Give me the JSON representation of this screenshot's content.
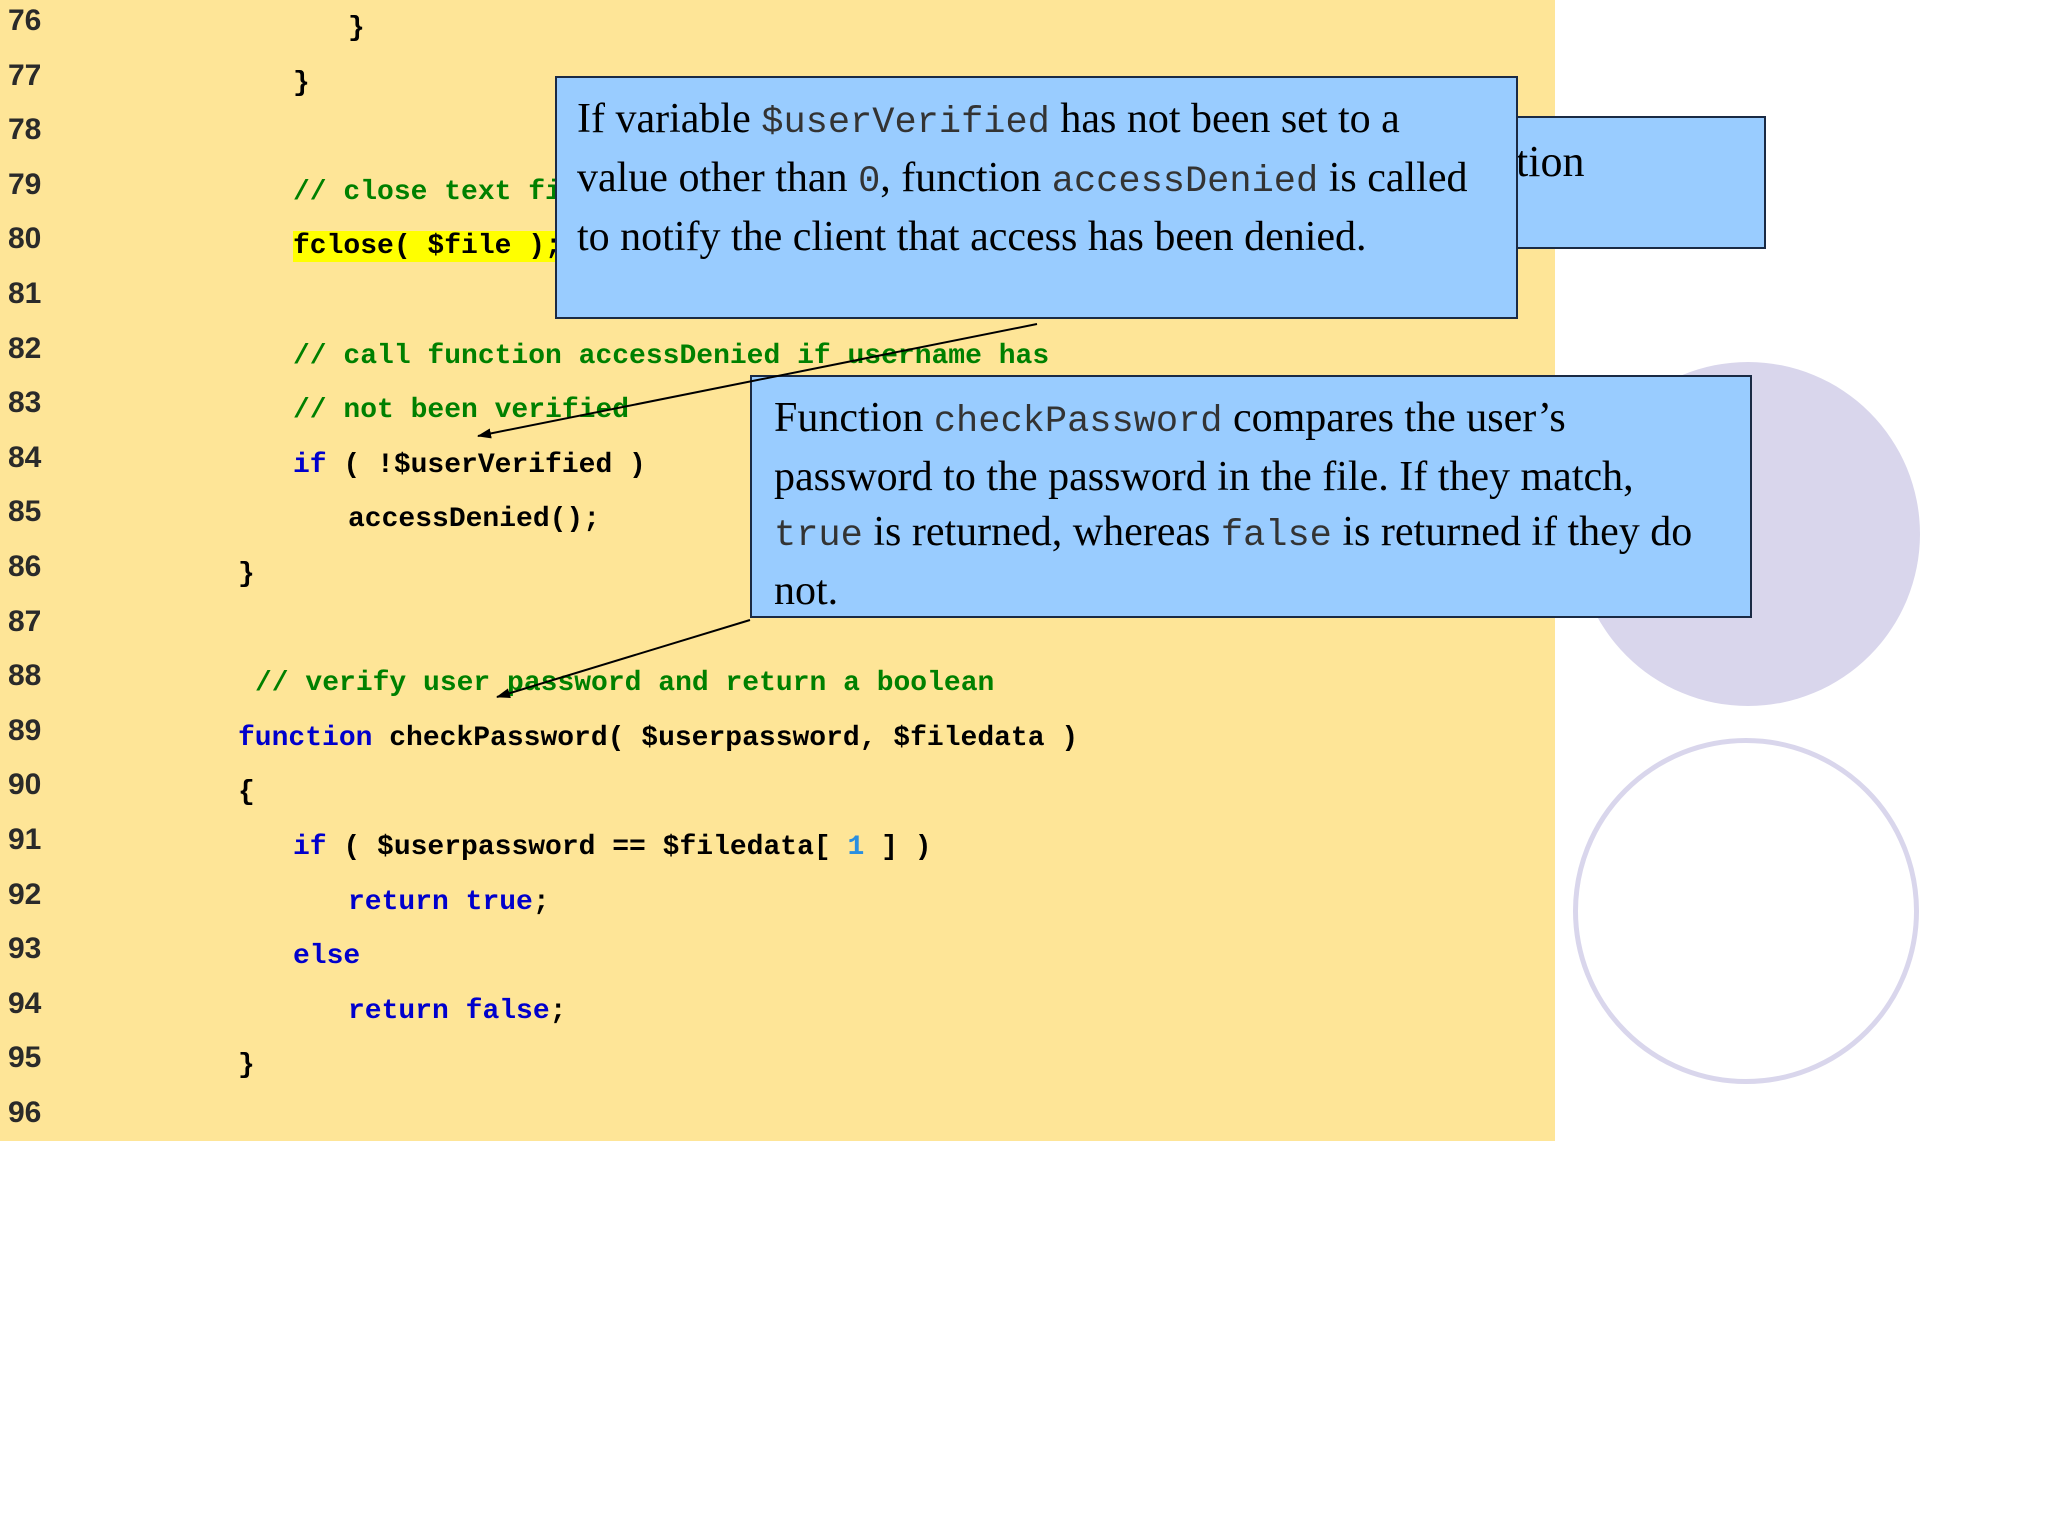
{
  "code_lines": [
    {
      "num": "76",
      "indent": 348,
      "parts": [
        {
          "t": "}",
          "c": ""
        }
      ]
    },
    {
      "num": "77",
      "indent": 293,
      "parts": [
        {
          "t": "}",
          "c": ""
        }
      ]
    },
    {
      "num": "78",
      "indent": 293,
      "parts": []
    },
    {
      "num": "79",
      "indent": 293,
      "parts": [
        {
          "t": "// close text file",
          "c": "cm"
        }
      ]
    },
    {
      "num": "80",
      "indent": 293,
      "parts": [
        {
          "t": "fclose( $file );",
          "c": "hl"
        }
      ]
    },
    {
      "num": "81",
      "indent": 293,
      "parts": []
    },
    {
      "num": "82",
      "indent": 293,
      "parts": [
        {
          "t": "// call function accessDenied if username has",
          "c": "cm"
        }
      ]
    },
    {
      "num": "83",
      "indent": 293,
      "parts": [
        {
          "t": "// not been verified",
          "c": "cm"
        }
      ]
    },
    {
      "num": "84",
      "indent": 293,
      "parts": [
        {
          "t": "if",
          "c": "kw"
        },
        {
          "t": " ( !$userVerified )",
          "c": ""
        }
      ]
    },
    {
      "num": "85",
      "indent": 348,
      "parts": [
        {
          "t": "accessDenied();",
          "c": ""
        }
      ]
    },
    {
      "num": "86",
      "indent": 238,
      "parts": [
        {
          "t": "}",
          "c": ""
        }
      ]
    },
    {
      "num": "87",
      "indent": 238,
      "parts": []
    },
    {
      "num": "88",
      "indent": 255,
      "parts": [
        {
          "t": "// verify user password and return a boolean",
          "c": "cm"
        }
      ]
    },
    {
      "num": "89",
      "indent": 238,
      "parts": [
        {
          "t": "function",
          "c": "kw"
        },
        {
          "t": " checkPassword( $userpassword, $filedata )",
          "c": ""
        }
      ]
    },
    {
      "num": "90",
      "indent": 238,
      "parts": [
        {
          "t": "{",
          "c": ""
        }
      ]
    },
    {
      "num": "91",
      "indent": 293,
      "parts": [
        {
          "t": "if",
          "c": "kw"
        },
        {
          "t": " ( $userpassword == $filedata[ ",
          "c": ""
        },
        {
          "t": "1",
          "c": "num"
        },
        {
          "t": " ] )",
          "c": ""
        }
      ]
    },
    {
      "num": "92",
      "indent": 348,
      "parts": [
        {
          "t": "return",
          "c": "kw"
        },
        {
          "t": " ",
          "c": ""
        },
        {
          "t": "true",
          "c": "kw"
        },
        {
          "t": ";",
          "c": ""
        }
      ]
    },
    {
      "num": "93",
      "indent": 293,
      "parts": [
        {
          "t": "else",
          "c": "kw"
        }
      ]
    },
    {
      "num": "94",
      "indent": 348,
      "parts": [
        {
          "t": "return",
          "c": "kw"
        },
        {
          "t": " ",
          "c": ""
        },
        {
          "t": "false",
          "c": "kw"
        },
        {
          "t": ";",
          "c": ""
        }
      ]
    },
    {
      "num": "95",
      "indent": 238,
      "parts": [
        {
          "t": "}",
          "c": ""
        }
      ]
    },
    {
      "num": "96",
      "indent": 238,
      "parts": []
    }
  ],
  "callouts": {
    "hidden_fragment": "tion",
    "user_verified": [
      {
        "t": "If variable ",
        "m": false
      },
      {
        "t": "$userVerified",
        "m": true
      },
      {
        "t": " has not been set to a value other than ",
        "m": false
      },
      {
        "t": "0",
        "m": true
      },
      {
        "t": ", function ",
        "m": false
      },
      {
        "t": "accessDenied",
        "m": true
      },
      {
        "t": " is called to notify the client that access has been denied.",
        "m": false
      }
    ],
    "check_password": [
      {
        "t": "Function ",
        "m": false
      },
      {
        "t": "checkPassword",
        "m": true
      },
      {
        "t": " compares the user’s password to the password in the file. If they match, ",
        "m": false
      },
      {
        "t": "true",
        "m": true
      },
      {
        "t": " is returned, whereas ",
        "m": false
      },
      {
        "t": "false",
        "m": true
      },
      {
        "t": " is returned if they do not.",
        "m": false
      }
    ]
  },
  "colors": {
    "code_background": "#fee597",
    "callout_background": "#99ccff",
    "keyword": "#0000cc",
    "comment": "#008000",
    "number": "#2a8fe0",
    "highlight": "#ffff00",
    "deco_circle": "#d9d6ec"
  }
}
